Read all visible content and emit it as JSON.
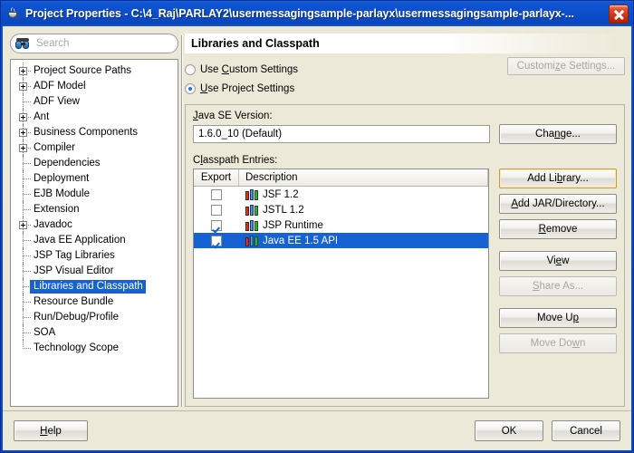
{
  "window": {
    "title": "Project Properties - C:\\4_Raj\\PARLAY2\\usermessagingsample-parlayx\\usermessagingsample-parlayx-...",
    "icon": "java-cup-icon",
    "close_label": "Close"
  },
  "search": {
    "placeholder": "Search",
    "icon": "binoculars-icon",
    "value": ""
  },
  "tree": {
    "items": [
      {
        "label": "Project Source Paths",
        "expandable": true,
        "selected": false
      },
      {
        "label": "ADF Model",
        "expandable": true,
        "selected": false
      },
      {
        "label": "ADF View",
        "expandable": false,
        "selected": false
      },
      {
        "label": "Ant",
        "expandable": true,
        "selected": false
      },
      {
        "label": "Business Components",
        "expandable": true,
        "selected": false
      },
      {
        "label": "Compiler",
        "expandable": true,
        "selected": false
      },
      {
        "label": "Dependencies",
        "expandable": false,
        "selected": false
      },
      {
        "label": "Deployment",
        "expandable": false,
        "selected": false
      },
      {
        "label": "EJB Module",
        "expandable": false,
        "selected": false
      },
      {
        "label": "Extension",
        "expandable": false,
        "selected": false
      },
      {
        "label": "Javadoc",
        "expandable": true,
        "selected": false
      },
      {
        "label": "Java EE Application",
        "expandable": false,
        "selected": false
      },
      {
        "label": "JSP Tag Libraries",
        "expandable": false,
        "selected": false
      },
      {
        "label": "JSP Visual Editor",
        "expandable": false,
        "selected": false
      },
      {
        "label": "Libraries and Classpath",
        "expandable": false,
        "selected": true
      },
      {
        "label": "Resource Bundle",
        "expandable": false,
        "selected": false
      },
      {
        "label": "Run/Debug/Profile",
        "expandable": false,
        "selected": false
      },
      {
        "label": "SOA",
        "expandable": false,
        "selected": false
      },
      {
        "label": "Technology Scope",
        "expandable": false,
        "selected": false
      }
    ]
  },
  "panel": {
    "title": "Libraries and Classpath",
    "settings_mode": {
      "custom": {
        "label_pre": "Use ",
        "mnemonic": "C",
        "label_post": "ustom Settings",
        "checked": false
      },
      "project": {
        "label_pre": "",
        "mnemonic": "U",
        "label_post": "se Project Settings",
        "checked": true
      }
    },
    "customize_button": {
      "pre": "Customi",
      "mnemonic": "z",
      "post": "e Settings...",
      "enabled": false
    },
    "java_se": {
      "label_pre": "",
      "label_mnemonic": "J",
      "label_post": "ava SE Version:",
      "value": "1.6.0_10 (Default)",
      "change_button": {
        "pre": "Cha",
        "mnemonic": "n",
        "post": "ge..."
      }
    },
    "classpath": {
      "label_pre": "C",
      "label_mnemonic": "l",
      "label_post": "asspath Entries:",
      "columns": [
        "Export",
        "Description"
      ],
      "rows": [
        {
          "export": false,
          "description": "JSF 1.2",
          "selected": false,
          "icon": "library-books-icon"
        },
        {
          "export": false,
          "description": "JSTL 1.2",
          "selected": false,
          "icon": "library-books-icon"
        },
        {
          "export": true,
          "description": "JSP Runtime",
          "selected": false,
          "icon": "library-books-icon"
        },
        {
          "export": true,
          "description": "Java EE 1.5 API",
          "selected": true,
          "icon": "library-books-icon"
        }
      ]
    },
    "side_buttons": [
      {
        "pre": "Add Li",
        "mnemonic": "b",
        "post": "rary...",
        "enabled": true,
        "focused": true,
        "name": "add-library-button"
      },
      {
        "pre": "",
        "mnemonic": "A",
        "post": "dd JAR/Directory...",
        "enabled": true,
        "focused": false,
        "name": "add-jar-directory-button"
      },
      {
        "pre": "",
        "mnemonic": "R",
        "post": "emove",
        "enabled": true,
        "focused": false,
        "name": "remove-button"
      },
      {
        "pre": "Vi",
        "mnemonic": "e",
        "post": "w",
        "enabled": true,
        "focused": false,
        "name": "view-button"
      },
      {
        "pre": "",
        "mnemonic": "S",
        "post": "hare As...",
        "enabled": false,
        "focused": false,
        "name": "share-as-button"
      },
      {
        "pre": "Move U",
        "mnemonic": "p",
        "post": "",
        "enabled": true,
        "focused": false,
        "name": "move-up-button"
      },
      {
        "pre": "Move Do",
        "mnemonic": "w",
        "post": "n",
        "enabled": false,
        "focused": false,
        "name": "move-down-button"
      }
    ]
  },
  "footer": {
    "help": {
      "pre": "",
      "mnemonic": "H",
      "post": "elp"
    },
    "ok": "OK",
    "cancel": "Cancel"
  },
  "colors": {
    "titlebar_blue": "#0d4fcc",
    "selection_blue": "#1762d2",
    "dialog_bg": "#ece9d8",
    "focus_gold": "#c99a2e",
    "close_red": "#c42f12"
  }
}
